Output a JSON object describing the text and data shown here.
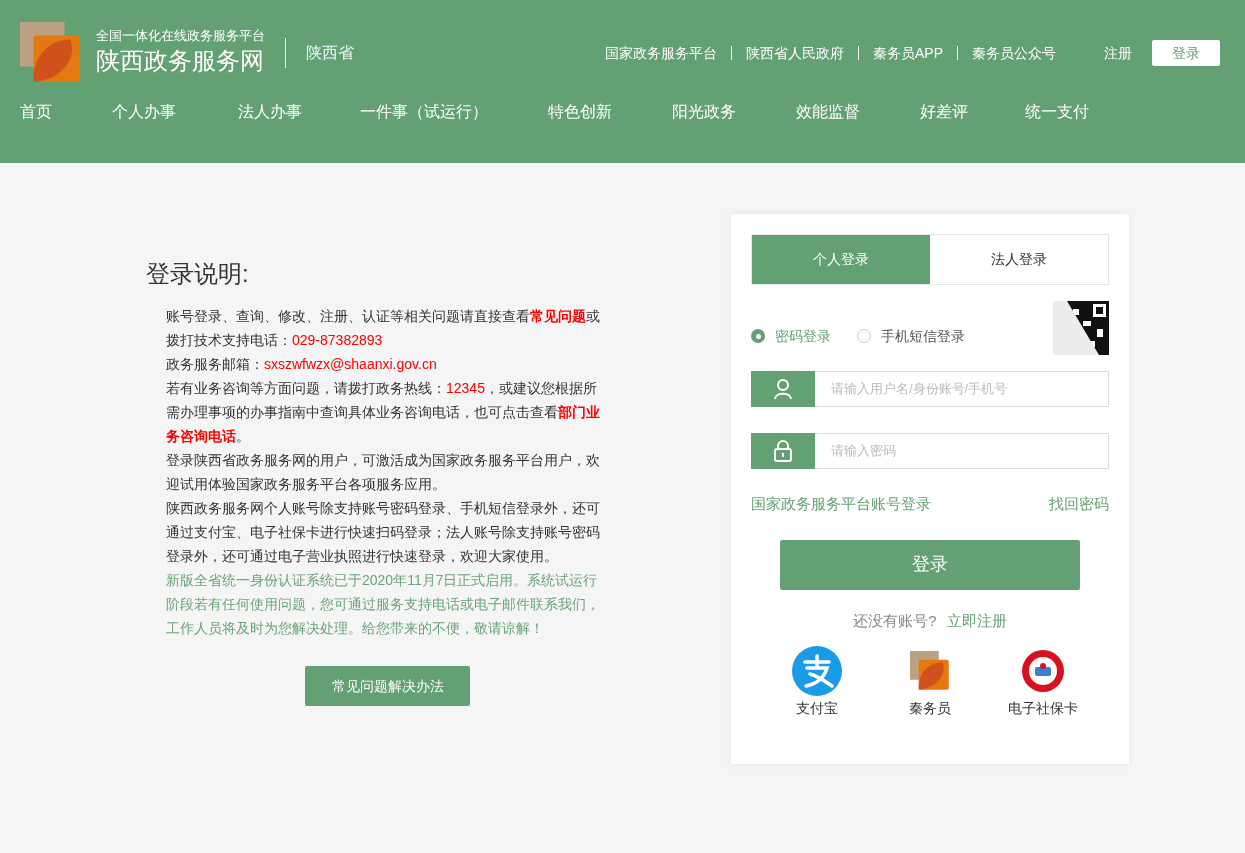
{
  "header": {
    "platform": "全国一体化在线政务服务平台",
    "site_name": "陕西政务服务网",
    "region": "陕西省",
    "links": [
      "国家政务服务平台",
      "陕西省人民政府",
      "秦务员APP",
      "秦务员公众号"
    ],
    "register": "注册",
    "login": "登录"
  },
  "nav": [
    {
      "label": "首页"
    },
    {
      "label": "个人办事"
    },
    {
      "label": "法人办事"
    },
    {
      "label": "一件事（试运行）"
    },
    {
      "label": "特色创新"
    },
    {
      "label": "阳光政务"
    },
    {
      "label": "效能监督"
    },
    {
      "label": "好差评"
    },
    {
      "label": "统一支付"
    }
  ],
  "instructions": {
    "title": "登录说明:",
    "paragraphs": [
      {
        "kind": "normal",
        "segments": [
          {
            "kind": "text",
            "text": "账号登录、查询、修改、注册、认证等相关问题请直接查看"
          },
          {
            "kind": "link",
            "text": "常见问题"
          },
          {
            "kind": "text",
            "text": "或拨打技术支持电话："
          },
          {
            "kind": "highlight",
            "text": "029-87382893"
          }
        ]
      },
      {
        "kind": "normal",
        "segments": [
          {
            "kind": "text",
            "text": "政务服务邮箱："
          },
          {
            "kind": "highlight",
            "text": "sxszwfwzx@shaanxi.gov.cn"
          }
        ]
      },
      {
        "kind": "normal",
        "segments": [
          {
            "kind": "text",
            "text": "若有业务咨询等方面问题，请拨打政务热线："
          },
          {
            "kind": "highlight",
            "text": "12345"
          },
          {
            "kind": "text",
            "text": "，或建议您根据所需办理事项的办事指南中查询具体业务咨询电话，也可点击查看"
          },
          {
            "kind": "link",
            "text": "部门业务咨询电话"
          },
          {
            "kind": "text",
            "text": "。"
          }
        ]
      },
      {
        "kind": "normal",
        "segments": [
          {
            "kind": "text",
            "text": "登录陕西省政务服务网的用户，可激活成为国家政务服务平台用户，欢迎试用体验国家政务服务平台各项服务应用。"
          }
        ]
      },
      {
        "kind": "normal",
        "segments": [
          {
            "kind": "text",
            "text": "陕西政务服务网个人账号除支持账号密码登录、手机短信登录外，还可通过支付宝、电子社保卡进行快速扫码登录；法人账号除支持账号密码登录外，还可通过电子营业执照进行快速登录，欢迎大家使用。"
          }
        ]
      },
      {
        "kind": "notice",
        "segments": [
          {
            "kind": "text",
            "text": "新版全省统一身份认证系统已于2020年11月7日正式启用。系统试运行阶段若有任何使用问题，您可通过服务支持电话或电子邮件联系我们，工作人员将及时为您解决处理。给您带来的不便，敬请谅解！"
          }
        ]
      }
    ],
    "faq_button": "常见问题解决办法"
  },
  "login": {
    "tabs": [
      {
        "label": "个人登录",
        "selected": true
      },
      {
        "label": "法人登录",
        "selected": false
      }
    ],
    "methods": [
      {
        "label": "密码登录",
        "selected": true
      },
      {
        "label": "手机短信登录",
        "selected": false
      }
    ],
    "username": {
      "placeholder": "请输入用户名/身份账号/手机号"
    },
    "password": {
      "placeholder": "请输入密码"
    },
    "national_login": "国家政务服务平台账号登录",
    "forgot": "找回密码",
    "submit": "登录",
    "no_account": "还没有账号?",
    "register": "立即注册",
    "third_party": [
      {
        "kind": "alipay",
        "label": "支付宝"
      },
      {
        "kind": "qinwuyuan",
        "label": "秦务员"
      },
      {
        "kind": "social",
        "label": "电子社保卡"
      }
    ]
  }
}
